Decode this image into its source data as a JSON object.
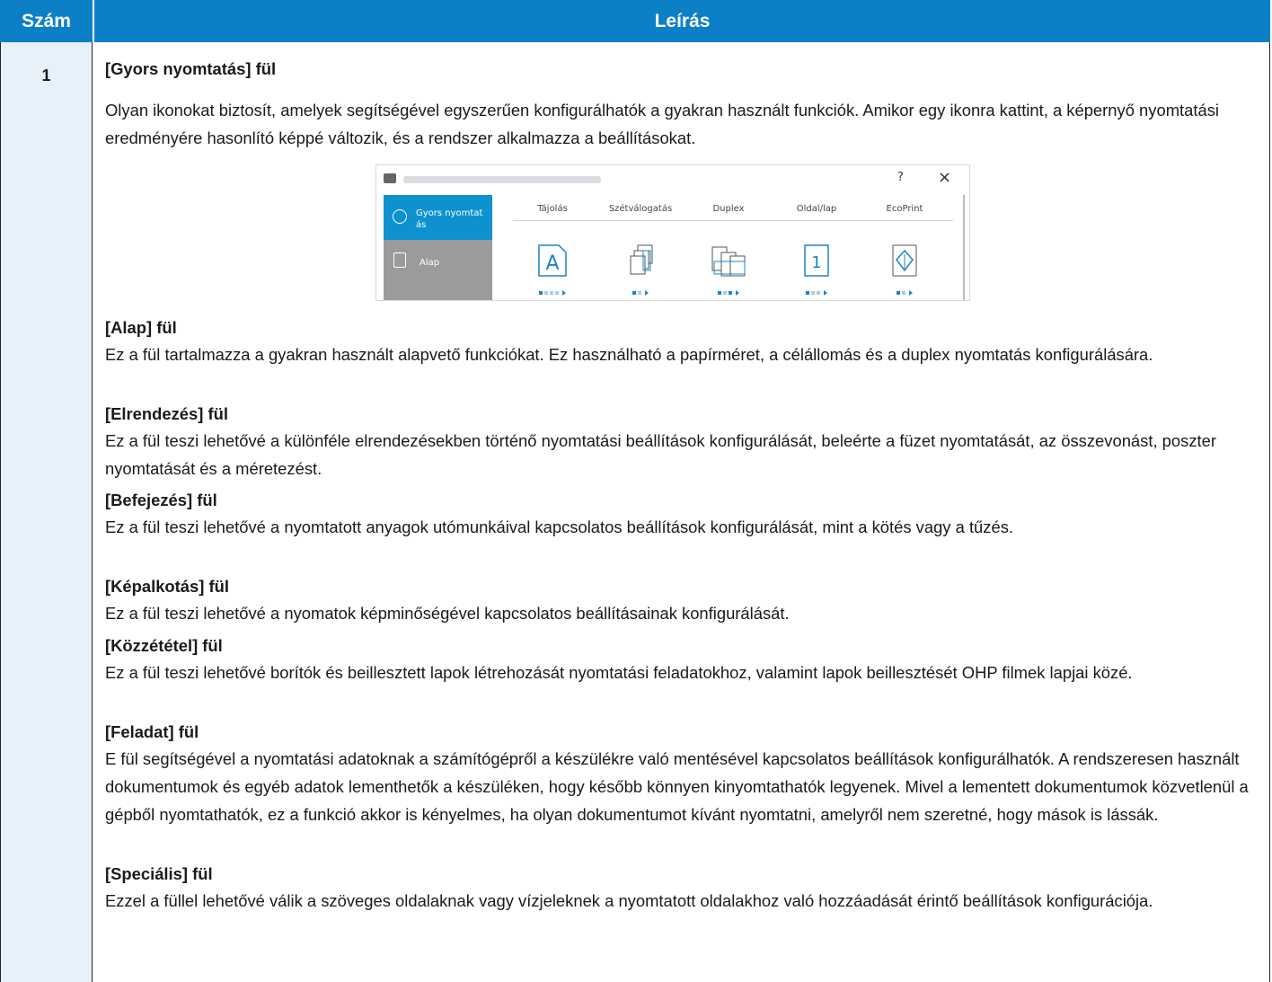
{
  "header": {
    "col_num": "Szám",
    "col_desc": "Leírás"
  },
  "row": {
    "number": "1",
    "sections": [
      {
        "title": "[Gyors nyomtatás] fül",
        "text": "Olyan ikonokat biztosít, amelyek segítségével egyszerűen konfigurálhatók a gyakran használt funkciók. Amikor egy ikonra kattint, a képernyő nyomtatási eredményére hasonlító képpé változik, és a rendszer alkalmazza a beállításokat."
      },
      {
        "title": "[Alap] fül",
        "text": "Ez a fül tartalmazza a gyakran használt alapvető funkciókat. Ez használható a papírméret, a célállomás és a duplex nyomtatás konfigurálására."
      },
      {
        "title": "[Elrendezés] fül",
        "text": "Ez a fül teszi lehetővé a különféle elrendezésekben történő nyomtatási beállítások konfigurálását, beleérte a füzet nyomtatását, az összevonást, poszter nyomtatását és a méretezést."
      },
      {
        "title": "[Befejezés] fül",
        "text": "Ez a fül teszi lehetővé a nyomtatott anyagok utómunkáival kapcsolatos beállítások konfigurálását, mint a kötés vagy a tűzés."
      },
      {
        "title": "[Képalkotás] fül",
        "text": "Ez a fül teszi lehetővé a nyomatok képminőségével kapcsolatos beállításainak konfigurálását."
      },
      {
        "title": "[Közzététel] fül",
        "text": "Ez a fül teszi lehetővé borítók és beillesztett lapok létrehozását nyomtatási feladatokhoz, valamint lapok beillesztését OHP filmek lapjai közé."
      },
      {
        "title": "[Feladat] fül",
        "text": "E fül segítségével a nyomtatási adatoknak a számítógépről a készülékre való mentésével kapcsolatos beállítások konfigurálhatók. A rendszeresen használt dokumentumok és egyéb adatok lementhetők a készüléken, hogy később könnyen kinyomtathatók legyenek. Mivel a lementett dokumentumok közvetlenül a gépből nyomtathatók, ez a funkció akkor is kényelmes, ha olyan dokumentumot kívánt nyomtatni, amelyről nem szeretné, hogy mások is lássák."
      },
      {
        "title": "[Speciális] fül",
        "text": "Ezzel a füllel lehetővé válik a szöveges oldalaknak vagy vízjeleknek a nyomtatott oldalakhoz való hozzáadását érintő beállítások konfigurációja."
      }
    ]
  },
  "screenshot": {
    "help": "?",
    "close": "×",
    "side_tabs": [
      "Gyors nyomtat ás",
      "Alap"
    ],
    "columns": [
      "Tájolás",
      "Szétválogatás",
      "Duplex",
      "Oldal/lap",
      "EcoPrint"
    ],
    "icon_letter": "A",
    "icon_page": "1",
    "icon_names": [
      "orientation-portrait-icon",
      "collate-icon",
      "duplex-icon",
      "pages-per-sheet-icon",
      "ecoprint-leaf-icon"
    ],
    "accent": "#0e91cf"
  },
  "colors": {
    "header_bg": "#0b80c6",
    "num_cell_bg": "#e6f1fa"
  }
}
